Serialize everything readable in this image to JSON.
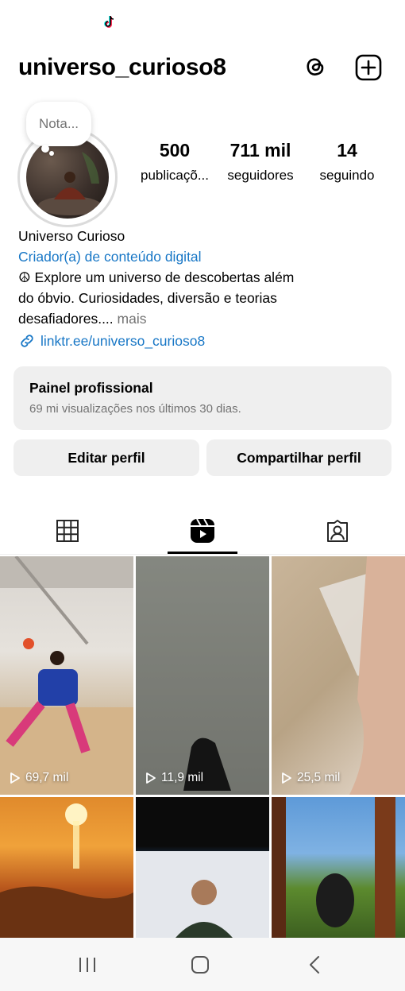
{
  "status_bar": {
    "icon": "tiktok-icon"
  },
  "header": {
    "username": "universo_curioso8",
    "threads_icon": "threads-icon",
    "add_icon": "plus-square-icon"
  },
  "note": {
    "text": "Nota..."
  },
  "stats": {
    "posts": {
      "value": "500",
      "label": "publicaçõ..."
    },
    "followers": {
      "value": "711 mil",
      "label": "seguidores"
    },
    "following": {
      "value": "14",
      "label": "seguindo"
    }
  },
  "bio": {
    "name": "Universo Curioso",
    "category": "Criador(a) de conteúdo digital",
    "line1": "☮ Explore um universo de descobertas além",
    "line2": "do óbvio. Curiosidades, diversão e teorias",
    "line3": "desafiadores....",
    "more": "mais",
    "link": "linktr.ee/universo_curioso8"
  },
  "dashboard": {
    "title": "Painel profissional",
    "subtitle": "69 mi visualizações nos últimos 30 dias."
  },
  "buttons": {
    "edit": "Editar perfil",
    "share": "Compartilhar perfil"
  },
  "tabs": [
    {
      "icon": "grid-icon"
    },
    {
      "icon": "reels-icon",
      "active": true
    },
    {
      "icon": "tagged-icon"
    }
  ],
  "reels": [
    {
      "views": "69,7 mil"
    },
    {
      "views": "11,9 mil"
    },
    {
      "views": "25,5 mil"
    },
    {
      "views": ""
    },
    {
      "views": ""
    },
    {
      "views": ""
    }
  ],
  "navbar": {
    "recent": "recent-apps-icon",
    "home": "home-icon",
    "back": "back-icon"
  }
}
